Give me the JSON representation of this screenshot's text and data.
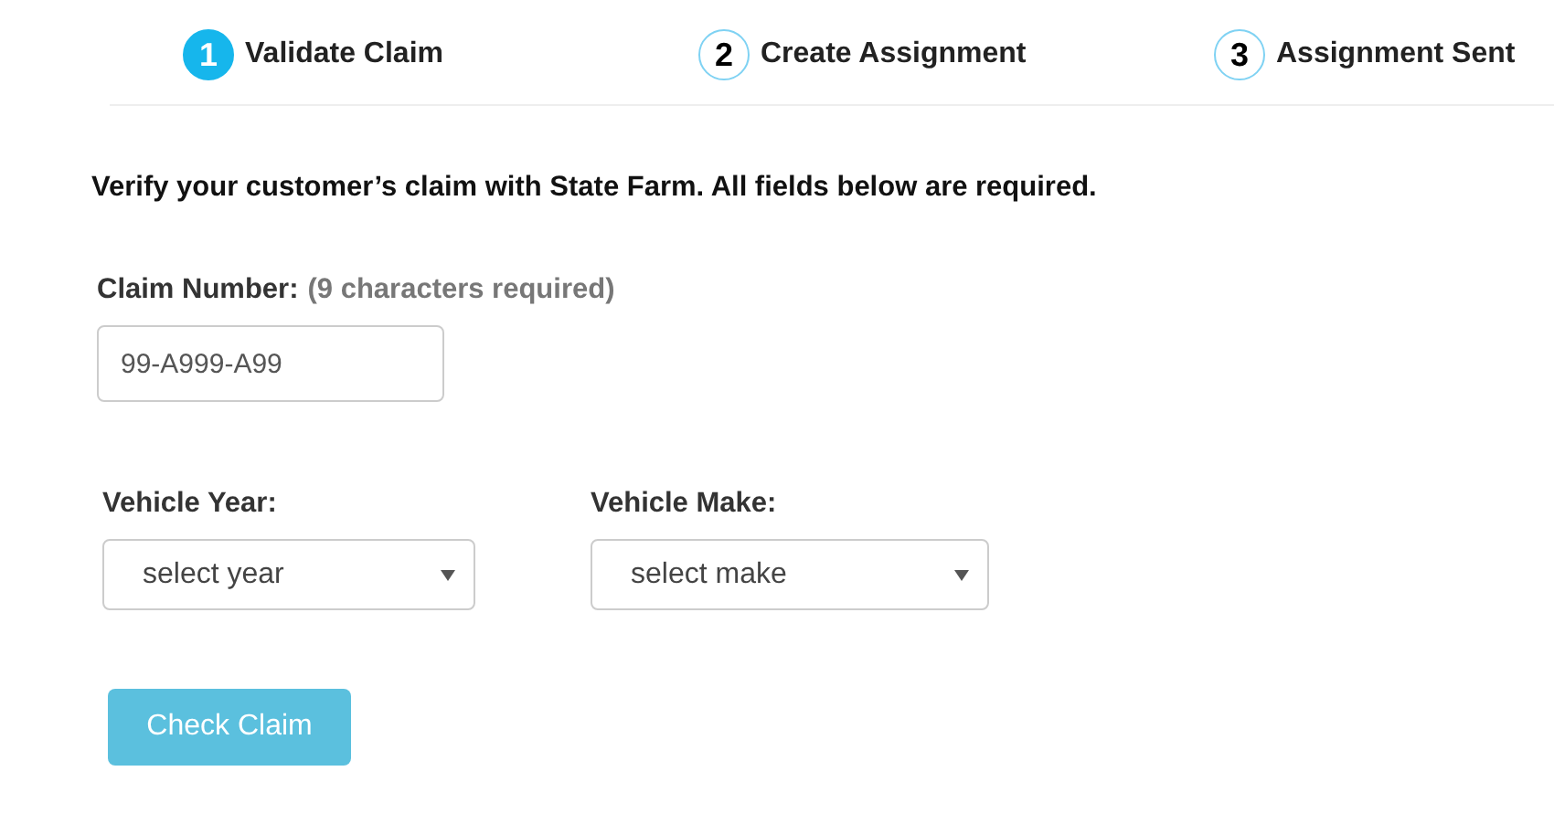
{
  "steps": [
    {
      "number": "1",
      "label": "Validate Claim",
      "selected": true
    },
    {
      "number": "2",
      "label": "Create Assignment",
      "selected": false
    },
    {
      "number": "3",
      "label": "Assignment Sent",
      "selected": false
    }
  ],
  "instructions": "Verify your customer’s claim with State Farm. All fields below are required.",
  "claim_number": {
    "label": "Claim Number:",
    "hint": "(9 characters required)",
    "placeholder": "99-A999-A99"
  },
  "selects": [
    {
      "label": "Vehicle Year:",
      "value": "select year"
    },
    {
      "label": "Vehicle Make:",
      "value": "select make"
    }
  ],
  "check_button": {
    "label": "Check Claim",
    "disabled": true
  }
}
